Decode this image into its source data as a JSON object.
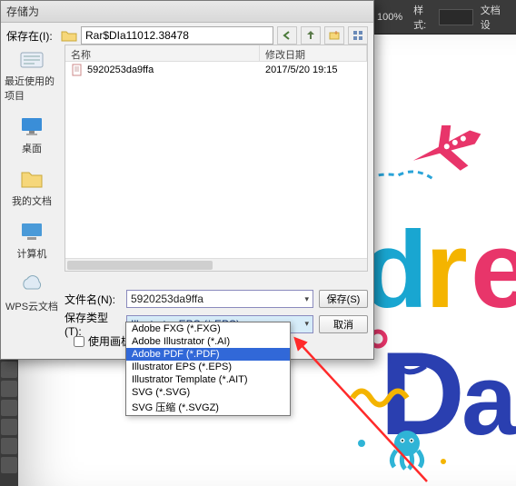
{
  "app_topbar": {
    "zoom": "100%",
    "style_label": "样式:",
    "doc_label": "文档设"
  },
  "toolstrip": {
    "items": [
      0,
      1,
      2,
      3,
      4,
      5,
      6,
      7,
      8,
      9,
      10,
      11,
      12
    ]
  },
  "dialog": {
    "title": "存储为",
    "location_label": "保存在(I):",
    "location_value": "Rar$DIa11012.38478",
    "columns": {
      "name": "名称",
      "date": "修改日期"
    },
    "file": {
      "name": "5920253da9ffa",
      "date": "2017/5/20 19:15"
    },
    "filename_label": "文件名(N):",
    "filename_value": "5920253da9ffa",
    "filetype_label": "保存类型(T):",
    "filetype_value": "Illustrator EPS (*.EPS)",
    "save_btn": "保存(S)",
    "cancel_btn": "取消",
    "artboard_label": "使用画板(U)",
    "sidebar": [
      {
        "label": "最近使用的项目"
      },
      {
        "label": "桌面"
      },
      {
        "label": "我的文档"
      },
      {
        "label": "计算机"
      },
      {
        "label": "WPS云文档"
      }
    ],
    "filetype_options": [
      "Adobe FXG (*.FXG)",
      "Adobe Illustrator (*.AI)",
      "Adobe PDF (*.PDF)",
      "Illustrator EPS (*.EPS)",
      "Illustrator Template (*.AIT)",
      "SVG (*.SVG)",
      "SVG 压缩 (*.SVGZ)"
    ],
    "filetype_selected_index": 2
  }
}
